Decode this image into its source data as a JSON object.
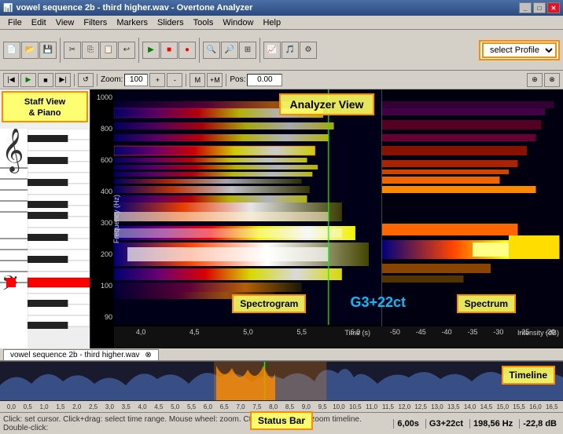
{
  "titlebar": {
    "title": "vowel sequence 2b - third higher.wav - Overtone Analyzer",
    "controls": [
      "_",
      "□",
      "✕"
    ]
  },
  "menubar": {
    "items": [
      "File",
      "Edit",
      "View",
      "Filters",
      "Markers",
      "Sliders",
      "Tools",
      "Window",
      "Help"
    ]
  },
  "toolbar": {
    "profile_label": "select Profile",
    "profile_placeholder": "select Profile"
  },
  "toolbar2": {
    "zoom_value": "100",
    "position_value": "0.00"
  },
  "labels": {
    "staff_view": "Staff View\n& Piano",
    "analyzer_view": "Analyzer View",
    "spectrogram": "Spectrogram",
    "spectrum": "Spectrum",
    "g3_label": "G3+22ct",
    "timeline": "Timeline",
    "status_bar": "Status Bar"
  },
  "yaxis": {
    "title": "Frequency (Hz)",
    "values": [
      "1000",
      "800",
      "600",
      "400",
      "300",
      "200",
      "100",
      "90"
    ]
  },
  "xaxis": {
    "title": "Time (s)",
    "spectrogram_values": [
      "4,0",
      "4,5",
      "5,0",
      "5,5",
      "6,0"
    ],
    "spectrum_title": "Intensity (dB)",
    "spectrum_values": [
      "-50",
      "-45",
      "-40",
      "-35",
      "-30",
      "-25",
      "-20"
    ]
  },
  "timeline": {
    "labels": [
      "0,0",
      "0,5",
      "1,0",
      "1,5",
      "2,0",
      "2,5",
      "3,0",
      "3,5",
      "4,0",
      "4,5",
      "5,0",
      "5,5",
      "6,0",
      "6,5",
      "7,0",
      "7,5",
      "8,0",
      "8,5",
      "9,0",
      "9,5",
      "10,0",
      "10,5",
      "11,0",
      "11,5",
      "12,0",
      "12,5",
      "13,0",
      "13,5",
      "14,0",
      "14,5",
      "15,0",
      "15,5",
      "16,0",
      "16,5"
    ]
  },
  "file_tab": {
    "label": "vowel sequence 2b - third higher.wav"
  },
  "statusbar": {
    "hint": "Click: set cursor. Click+drag: select time range. Mouse wheel: zoom. Ctrl+mouse wheel: zoom timeline. Double-click:",
    "time": "6,00s",
    "note": "G3+22ct",
    "freq": "198,56 Hz",
    "level": "-22,8 dB"
  }
}
